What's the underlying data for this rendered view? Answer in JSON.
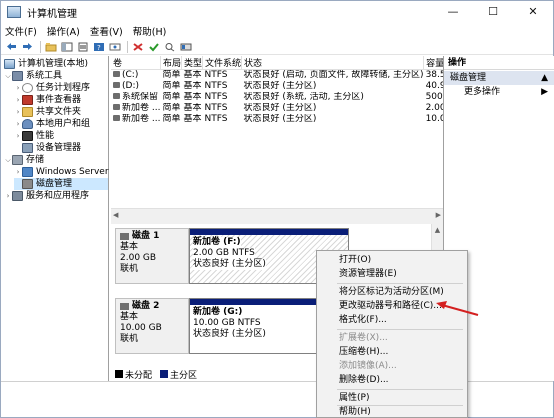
{
  "window": {
    "title": "计算机管理",
    "controls": {
      "minimize": "—",
      "maximize": "☐",
      "close": "✕"
    }
  },
  "menu": [
    "文件(F)",
    "操作(A)",
    "查看(V)",
    "帮助(H)"
  ],
  "tree": {
    "root": "计算机管理(本地)",
    "system_tools": "系统工具",
    "task_scheduler": "任务计划程序",
    "event_viewer": "事件查看器",
    "shared_folders": "共享文件夹",
    "local_users": "本地用户和组",
    "performance": "性能",
    "device_manager": "设备管理器",
    "storage": "存储",
    "windows_server_backup": "Windows Server B",
    "disk_management": "磁盘管理",
    "services_apps": "服务和应用程序"
  },
  "volume_table": {
    "headers": [
      "卷",
      "布局",
      "类型",
      "文件系统",
      "状态",
      "容量"
    ],
    "rows": [
      [
        "(C:)",
        "简单",
        "基本",
        "NTFS",
        "状态良好 (启动, 页面文件, 故障转储, 主分区)",
        "38.5"
      ],
      [
        "(D:)",
        "简单",
        "基本",
        "NTFS",
        "状态良好 (主分区)",
        "40.9"
      ],
      [
        "系统保留",
        "简单",
        "基本",
        "NTFS",
        "状态良好 (系统, 活动, 主分区)",
        "500"
      ],
      [
        "新加卷 ...",
        "简单",
        "基本",
        "NTFS",
        "状态良好 (主分区)",
        "2.00"
      ],
      [
        "新加卷 ...",
        "简单",
        "基本",
        "NTFS",
        "状态良好 (主分区)",
        "10.0"
      ]
    ]
  },
  "disks": [
    {
      "name": "磁盘 1",
      "type": "基本",
      "size": "2.00 GB",
      "state": "联机",
      "partition": {
        "label": "新加卷  (F:)",
        "size_fs": "2.00 GB NTFS",
        "status": "状态良好 (主分区)"
      }
    },
    {
      "name": "磁盘 2",
      "type": "基本",
      "size": "10.00 GB",
      "state": "联机",
      "partition": {
        "label": "新加卷  (G:)",
        "size_fs": "10.00 GB NTFS",
        "status": "状态良好 (主分区)"
      }
    }
  ],
  "legend": {
    "unallocated": "未分配",
    "primary": "主分区",
    "unallocated_color": "#000000",
    "primary_color": "#0a1e78"
  },
  "actions": {
    "header": "操作",
    "group": "磁盘管理",
    "more": "更多操作"
  },
  "context_menu": {
    "items": [
      {
        "label": "打开(O)",
        "enabled": true
      },
      {
        "label": "资源管理器(E)",
        "enabled": true
      },
      {
        "label": "将分区标记为活动分区(M)",
        "enabled": true
      },
      {
        "label": "更改驱动器号和路径(C)...",
        "enabled": true
      },
      {
        "label": "格式化(F)...",
        "enabled": true
      },
      {
        "label": "扩展卷(X)...",
        "enabled": false
      },
      {
        "label": "压缩卷(H)...",
        "enabled": true
      },
      {
        "label": "添加镜像(A)...",
        "enabled": false
      },
      {
        "label": "删除卷(D)...",
        "enabled": true
      },
      {
        "label": "属性(P)",
        "enabled": true
      },
      {
        "label": "帮助(H)",
        "enabled": true
      }
    ]
  },
  "colors": {
    "selection": "#cce8ff",
    "partition_bar": "#0a1e78",
    "annotation_arrow": "#d42020"
  }
}
